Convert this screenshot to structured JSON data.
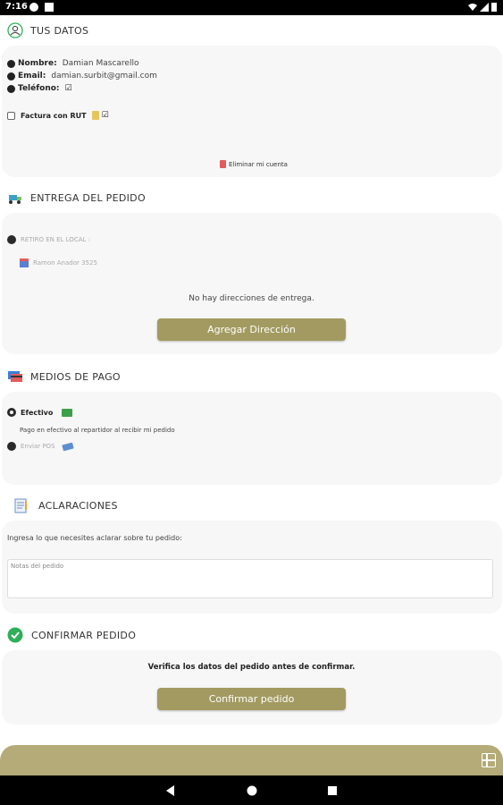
{
  "status_bar": {
    "time": "7:16"
  },
  "tus_datos": {
    "title": "TUS DATOS",
    "nombre_label": "Nombre:",
    "nombre_value": "Damian Mascarello",
    "email_label": "Email:",
    "email_value": "damian.surbit@gmail.com",
    "telefono_label": "Teléfono:",
    "factura_label": "Factura con RUT",
    "eliminar_label": "Eliminar mi cuenta"
  },
  "entrega": {
    "title": "ENTREGA DEL PEDIDO",
    "option_retiro": "RETIRO EN EL LOCAL :",
    "local_address": "Ramon Anador 3525",
    "empty_message": "No hay direcciones de entrega.",
    "add_button": "Agregar Dirección"
  },
  "pago": {
    "title": "MEDIOS DE PAGO",
    "option_efectivo": "Efectivo",
    "efectivo_desc": "Pago en efectivo al repartidor al recibir mi pedido",
    "option_pos": "Enviar POS"
  },
  "aclaraciones": {
    "title": "ACLARACIONES",
    "prompt": "Ingresa lo que necesites aclarar sobre tu pedido:",
    "placeholder": "Notas del pedido"
  },
  "confirmar": {
    "title": "CONFIRMAR PEDIDO",
    "message": "Verifica los datos del pedido antes de confirmar.",
    "button": "Confirmar pedido"
  },
  "colors": {
    "accent": "#a29a60",
    "bottom_bar": "#b4ab78",
    "check_green": "#2eaf5a"
  }
}
